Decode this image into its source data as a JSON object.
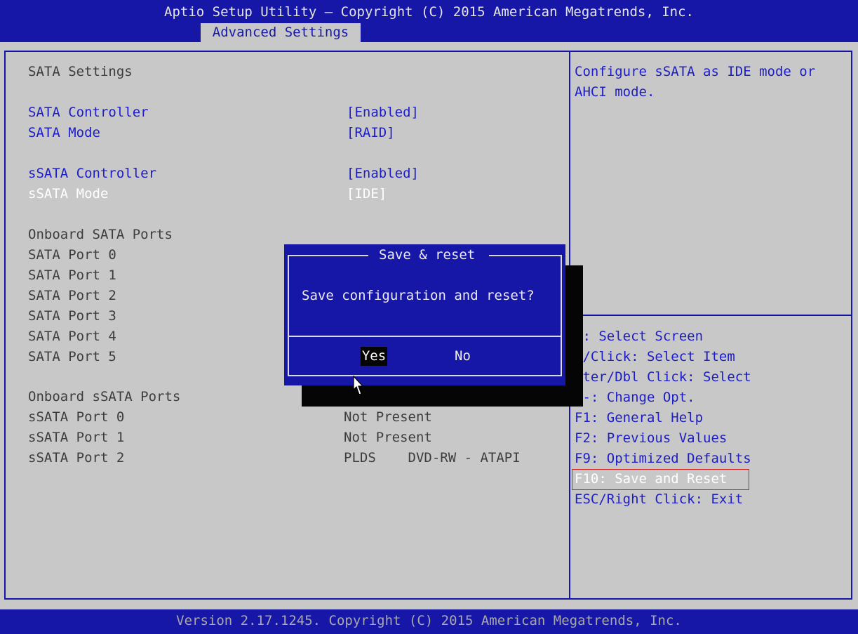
{
  "header": {
    "title": "Aptio Setup Utility – Copyright (C) 2015 American Megatrends, Inc.",
    "active_tab": "Advanced Settings"
  },
  "settings": {
    "section_title": "SATA Settings",
    "sata_controller": {
      "label": "SATA Controller",
      "value": "[Enabled]"
    },
    "sata_mode": {
      "label": "SATA Mode",
      "value": "[RAID]"
    },
    "ssata_controller": {
      "label": "sSATA Controller",
      "value": "[Enabled]"
    },
    "ssata_mode": {
      "label": "sSATA Mode",
      "value": "[IDE]"
    },
    "onboard_sata_title": "Onboard SATA Ports",
    "sata_ports": [
      "SATA Port 0",
      "SATA Port 1",
      "SATA Port 2",
      "SATA Port 3",
      "SATA Port 4",
      "SATA Port 5"
    ],
    "onboard_ssata_title": "Onboard sSATA Ports",
    "ssata_ports": [
      {
        "label": "sSATA Port 0",
        "value": "Not Present"
      },
      {
        "label": "sSATA Port 1",
        "value": "Not Present"
      },
      {
        "label": "sSATA Port 2",
        "value": "PLDS    DVD-RW - ATAPI"
      }
    ]
  },
  "help": {
    "line1": "Configure sSATA as IDE mode or",
    "line2": "AHCI mode."
  },
  "keys": [
    "+: Select Screen",
    "↓/Click: Select Item",
    "nter/Dbl Click: Select",
    "/-: Change Opt.",
    "F1: General Help",
    "F2: Previous Values",
    "F9: Optimized Defaults",
    "F10: Save and Reset",
    "ESC/Right Click: Exit"
  ],
  "dialog": {
    "title": "Save & reset",
    "message": "Save configuration and reset?",
    "yes_label": "Yes",
    "no_label": "No"
  },
  "footer": {
    "version": "Version 2.17.1245. Copyright (C) 2015 American Megatrends, Inc."
  },
  "colors": {
    "bios_blue": "#1717a7",
    "background_gray": "#c8c8c8",
    "highlight_red": "#d82020"
  },
  "icons": [
    "mouse-pointer-icon"
  ]
}
